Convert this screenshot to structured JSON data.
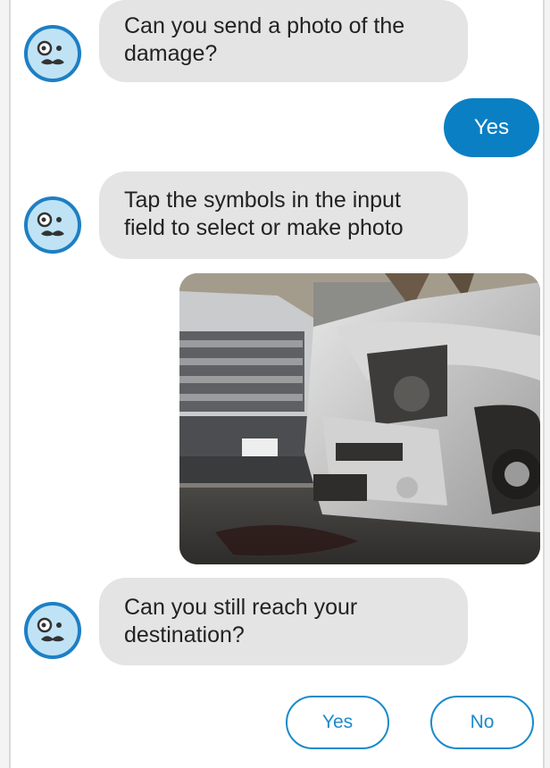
{
  "messages": [
    {
      "lines": [
        "Can you send a photo of the",
        "damage?"
      ]
    },
    {
      "lines": [
        "Tap the symbols in the input",
        "field to select or make photo"
      ]
    },
    {
      "lines": [
        "Can you still reach your",
        "destination?"
      ]
    }
  ],
  "user_reply": "Yes",
  "quick_replies": [
    "Yes",
    "No"
  ],
  "colors": {
    "accent": "#0b7fc3",
    "bot_bubble": "#e4e4e4",
    "outline": "#1a8acb",
    "avatar_ring": "#1e7fc4",
    "avatar_fill": "#bfe3f5"
  },
  "icons": {
    "avatar": "bot-face-icon"
  }
}
